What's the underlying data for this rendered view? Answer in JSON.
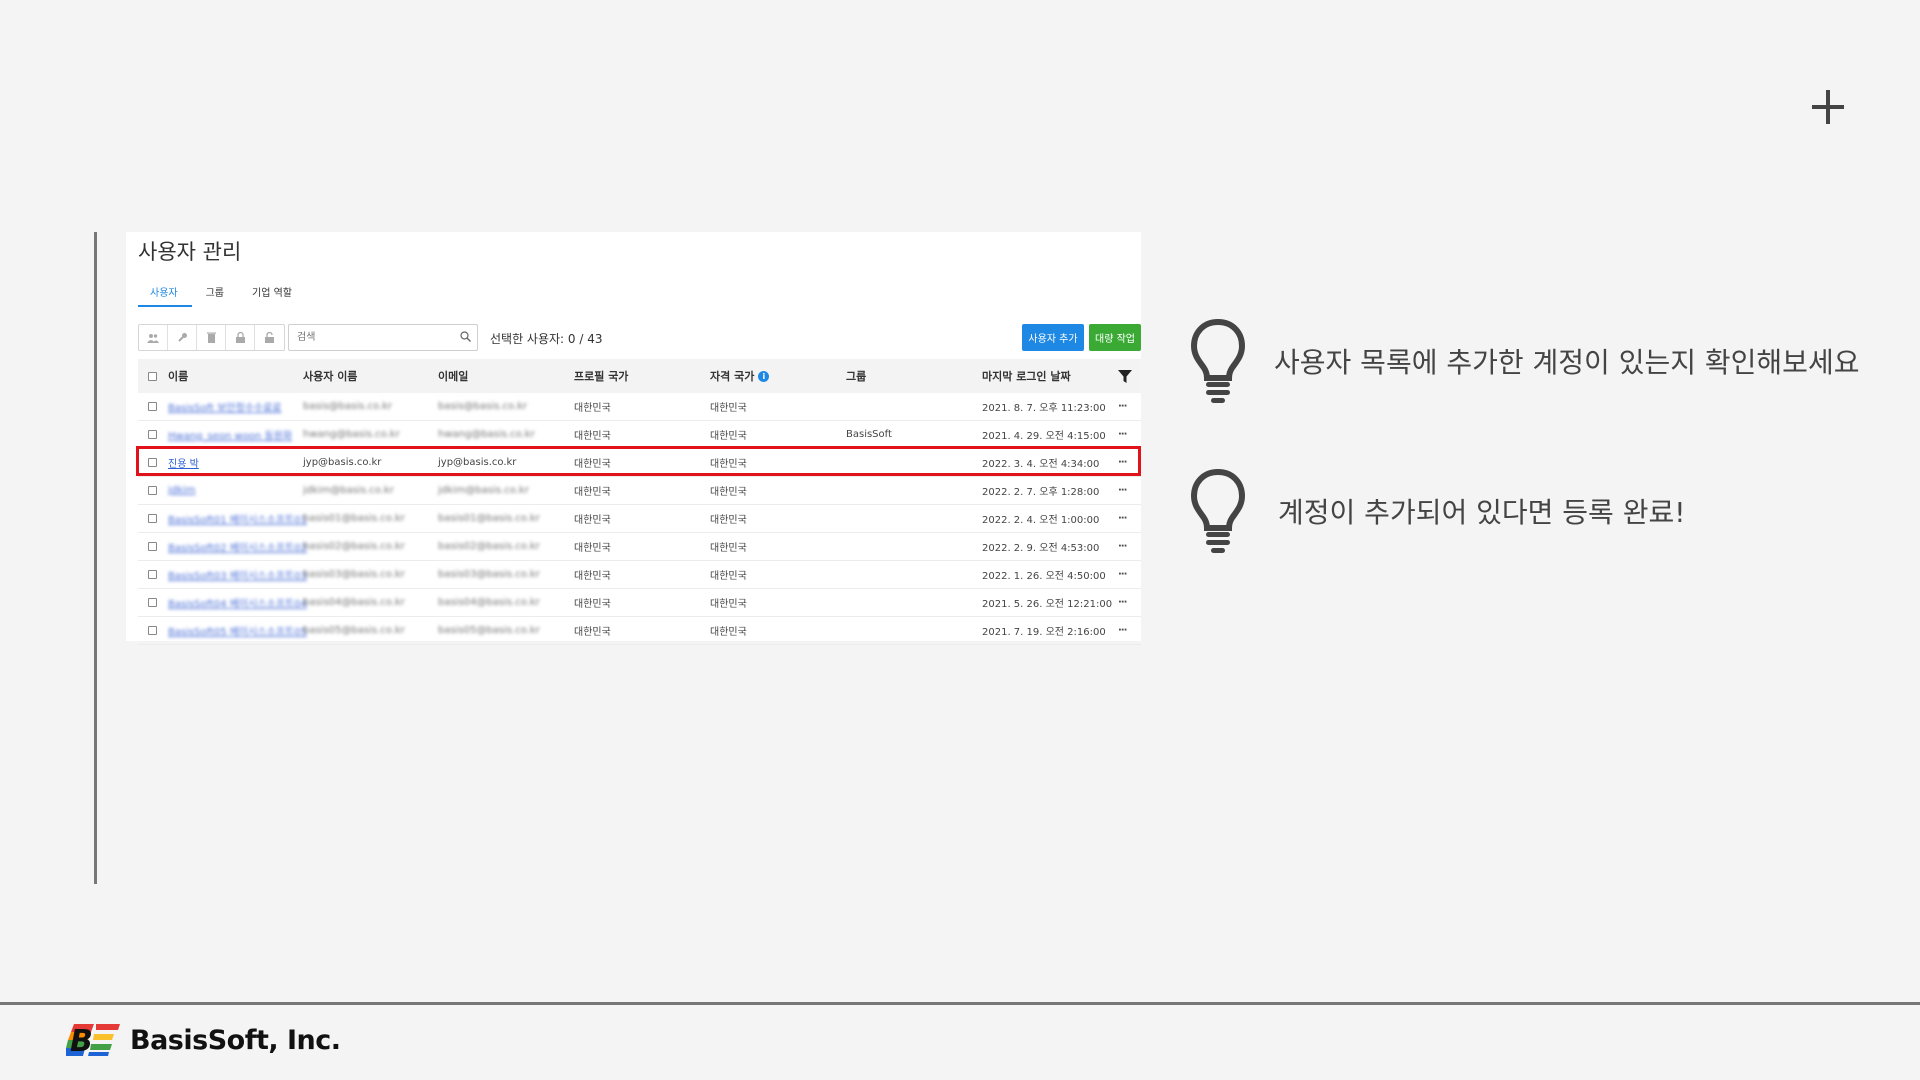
{
  "panel": {
    "title": "사용자 관리",
    "tabs": [
      {
        "label": "사용자",
        "active": true
      },
      {
        "label": "그룹",
        "active": false
      },
      {
        "label": "기업 역할",
        "active": false
      }
    ],
    "toolbar": {
      "search_placeholder": "검색",
      "selected_count": "선택한 사용자: 0 / 43",
      "add_user_label": "사용자 추가",
      "bulk_action_label": "대량 작업"
    },
    "table": {
      "headers": {
        "name": "이름",
        "username": "사용자 이름",
        "email": "이메일",
        "profile_country": "프로필 국가",
        "credential_country": "자격 국가",
        "group": "그룹",
        "last_login": "마지막 로그인 날짜"
      },
      "rows": [
        {
          "name": "BasisSoft 보안정수수료료",
          "username": "basis@basis.co.kr",
          "email": "basis@basis.co.kr",
          "profile_country": "대한민국",
          "credential_country": "대한민국",
          "group": "",
          "last_login": "2021. 8. 7. 오후 11:23:00",
          "blurred": true
        },
        {
          "name": "Hwang_seon woon 동원화",
          "username": "hwang@basis.co.kr",
          "email": "hwang@basis.co.kr",
          "profile_country": "대한민국",
          "credential_country": "대한민국",
          "group": "BasisSoft",
          "last_login": "2021. 4. 29. 오전 4:15:00",
          "blurred": true
        },
        {
          "name": "진용 박",
          "username": "jyp@basis.co.kr",
          "email": "jyp@basis.co.kr",
          "profile_country": "대한민국",
          "credential_country": "대한민국",
          "group": "",
          "last_login": "2022. 3. 4. 오전 4:34:00",
          "blurred": false
        },
        {
          "name": "jdkim",
          "username": "jdkim@basis.co.kr",
          "email": "jdkim@basis.co.kr",
          "profile_country": "대한민국",
          "credential_country": "대한민국",
          "group": "",
          "last_login": "2022. 2. 7. 오후 1:28:00",
          "blurred": true
        },
        {
          "name": "BasisSoft01 베이시스소프트01",
          "username": "basis01@basis.co.kr",
          "email": "basis01@basis.co.kr",
          "profile_country": "대한민국",
          "credential_country": "대한민국",
          "group": "",
          "last_login": "2022. 2. 4. 오전 1:00:00",
          "blurred": true
        },
        {
          "name": "BasisSoft02 베이시스소프트02",
          "username": "basis02@basis.co.kr",
          "email": "basis02@basis.co.kr",
          "profile_country": "대한민국",
          "credential_country": "대한민국",
          "group": "",
          "last_login": "2022. 2. 9. 오전 4:53:00",
          "blurred": true
        },
        {
          "name": "BasisSoft03 베이시스소프트03",
          "username": "basis03@basis.co.kr",
          "email": "basis03@basis.co.kr",
          "profile_country": "대한민국",
          "credential_country": "대한민국",
          "group": "",
          "last_login": "2022. 1. 26. 오전 4:50:00",
          "blurred": true
        },
        {
          "name": "BasisSoft04 베이시스소프트04",
          "username": "basis04@basis.co.kr",
          "email": "basis04@basis.co.kr",
          "profile_country": "대한민국",
          "credential_country": "대한민국",
          "group": "",
          "last_login": "2021. 5. 26. 오전 12:21:00",
          "blurred": true
        },
        {
          "name": "BasisSoft05 베이시스소프트05",
          "username": "basis05@basis.co.kr",
          "email": "basis05@basis.co.kr",
          "profile_country": "대한민국",
          "credential_country": "대한민국",
          "group": "",
          "last_login": "2021. 7. 19. 오전 2:16:00",
          "blurred": true
        }
      ],
      "more_label": "···"
    }
  },
  "tips": [
    {
      "icon": "lightbulb-icon",
      "text": "사용자 목록에 추가한 계정이 있는지 확인해보세요"
    },
    {
      "icon": "lightbulb-icon",
      "text": "계정이 추가되어 있다면 등록 완료!"
    }
  ],
  "footer": {
    "company": "BasisSoft, Inc."
  },
  "colors": {
    "accent_blue": "#1e88e5",
    "accent_green": "#3aaa35",
    "highlight_red": "#e2121b"
  }
}
